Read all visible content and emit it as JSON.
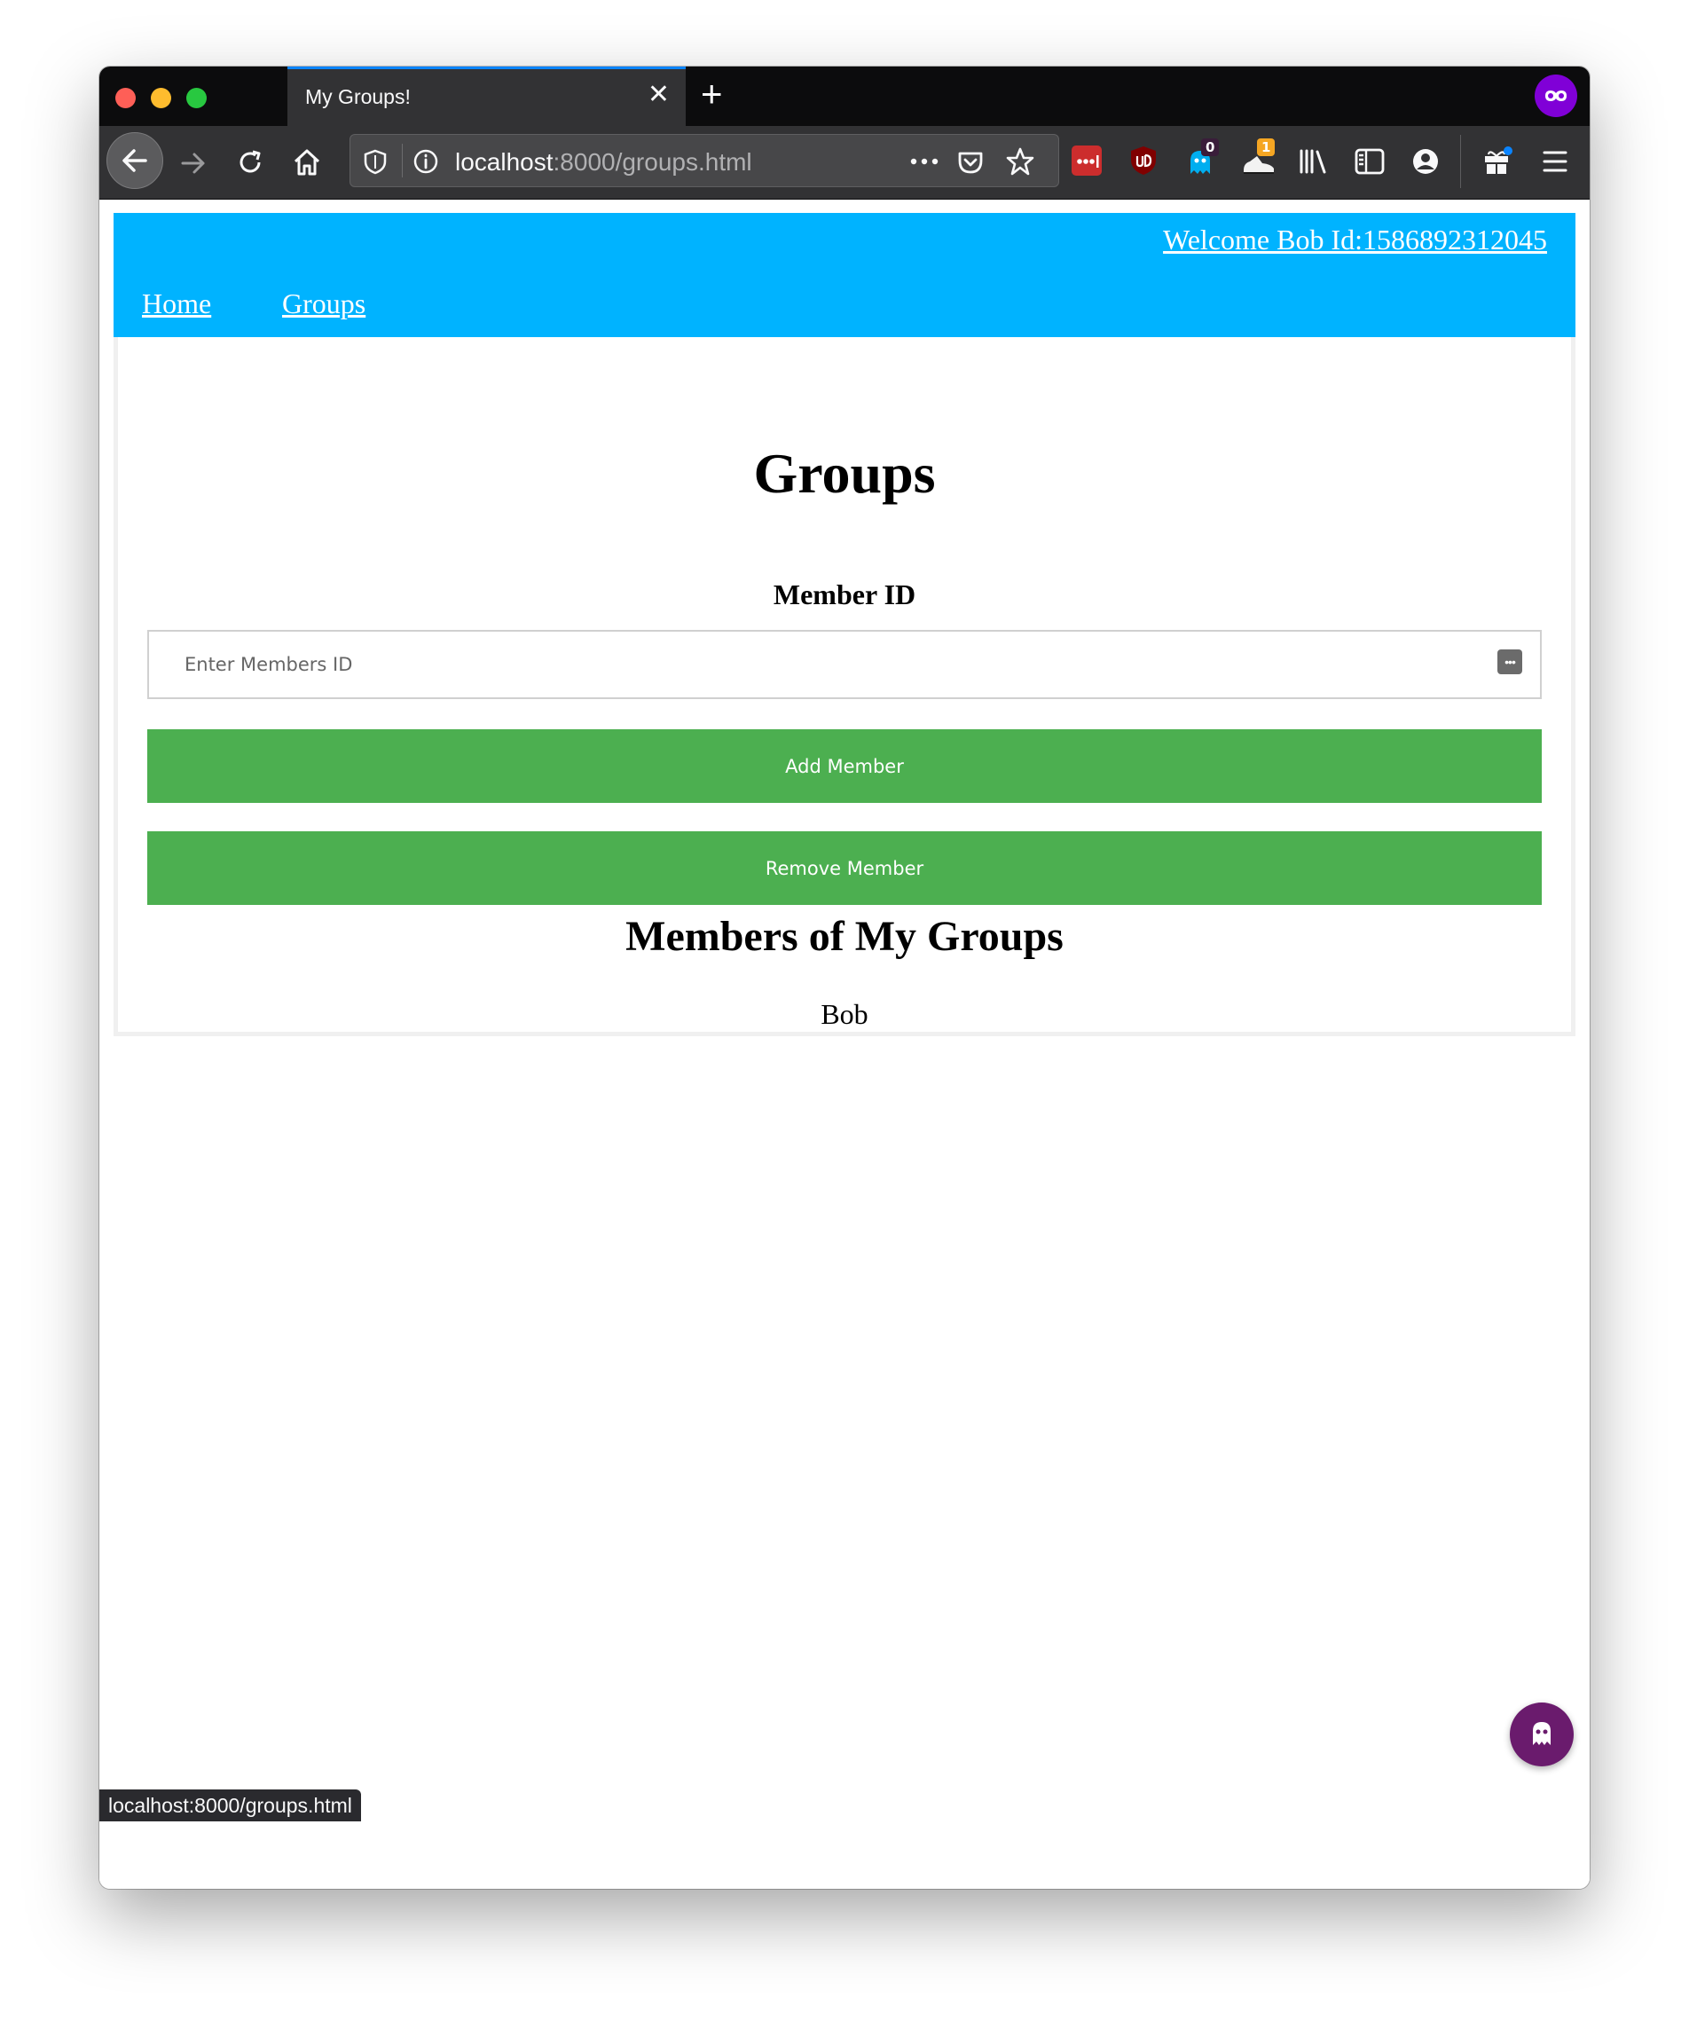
{
  "browser": {
    "tab_title": "My Groups!",
    "tab_close_glyph": "✕",
    "new_tab_glyph": "+",
    "url_host": "localhost",
    "url_rest": ":8000/groups.html",
    "badge_ghostery": "0",
    "badge_extension": "1",
    "status_url": "localhost:8000/groups.html",
    "colors": {
      "tab_accent": "#0a84ff",
      "chrome_dark": "#0c0c0d",
      "toolbar": "#323234"
    }
  },
  "header": {
    "welcome": "Welcome Bob Id:1586892312045",
    "nav": [
      {
        "label": "Home"
      },
      {
        "label": "Groups"
      }
    ],
    "bg_color": "#00b3ff"
  },
  "main": {
    "title": "Groups",
    "member_id_label": "Member ID",
    "member_id_placeholder": "Enter Members ID",
    "member_id_value": "",
    "add_button": "Add Member",
    "remove_button": "Remove Member",
    "members_heading": "Members of My Groups",
    "members": [
      "Bob"
    ],
    "button_color": "#4caf50"
  }
}
